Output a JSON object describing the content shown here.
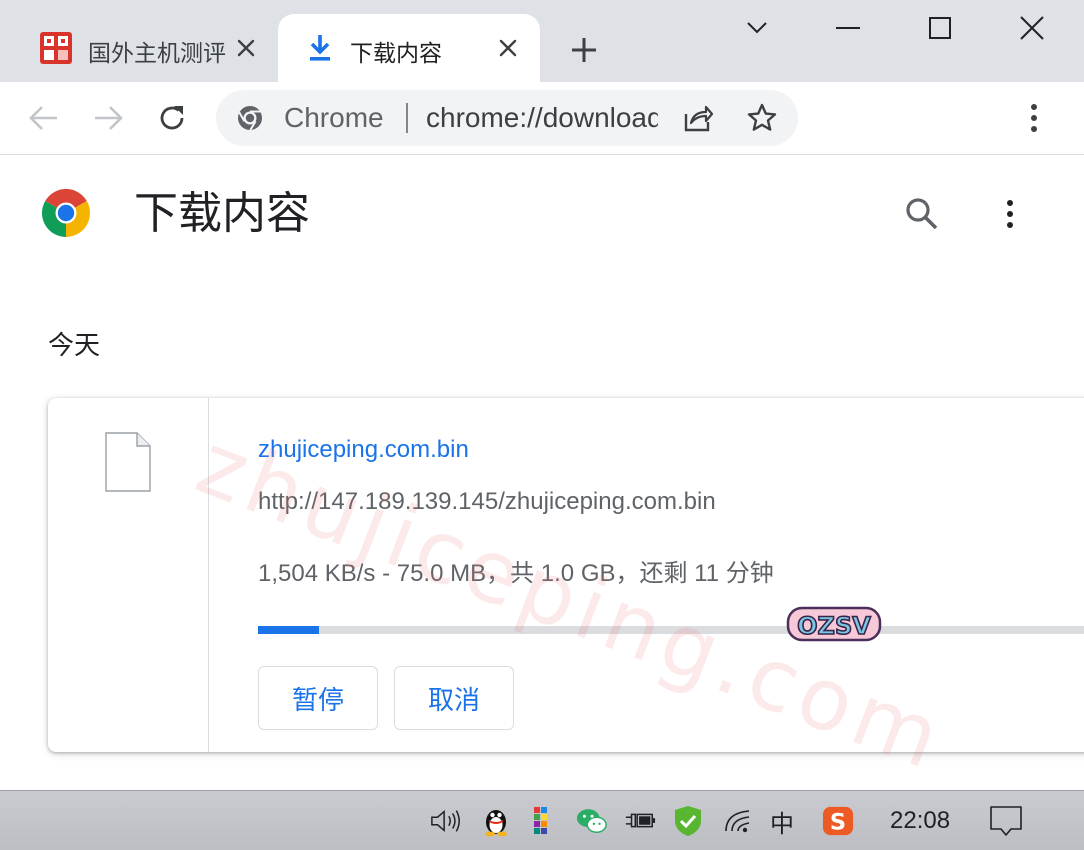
{
  "browser": {
    "tabs": [
      {
        "title": "国外主机测评",
        "active": false,
        "favicon": "site-favicon"
      },
      {
        "title": "下载内容",
        "active": true,
        "favicon": "download-icon"
      }
    ],
    "new_tab_icon": "plus-icon",
    "window_controls": [
      "chevron-down-icon",
      "minimize-icon",
      "maximize-icon",
      "close-icon"
    ],
    "omnibox": {
      "chip": "Chrome",
      "url": "chrome://downloads"
    },
    "accent_color": "#1a73e8"
  },
  "page": {
    "title": "下载内容",
    "date_header": "今天",
    "downloads": [
      {
        "file_name": "zhujiceping.com.bin",
        "url": "http://147.189.139.145/zhujiceping.com.bin",
        "status": "1,504 KB/s - 75.0 MB，共 1.0 GB，还剩 11 分钟",
        "progress_fraction": 0.0733,
        "buttons": {
          "pause": "暂停",
          "cancel": "取消"
        }
      }
    ],
    "watermark_text": "zhujiceping.com",
    "sticker_text": "OZSV"
  },
  "taskbar": {
    "tray_icons": [
      "speaker-icon",
      "qq-icon",
      "color-grid-icon",
      "wechat-icon",
      "power-icon",
      "shield-check-icon",
      "wifi-icon",
      "ime-icon",
      "sogou-icon"
    ],
    "ime_label": "中",
    "sogou_label": "S",
    "clock": "22:08"
  }
}
